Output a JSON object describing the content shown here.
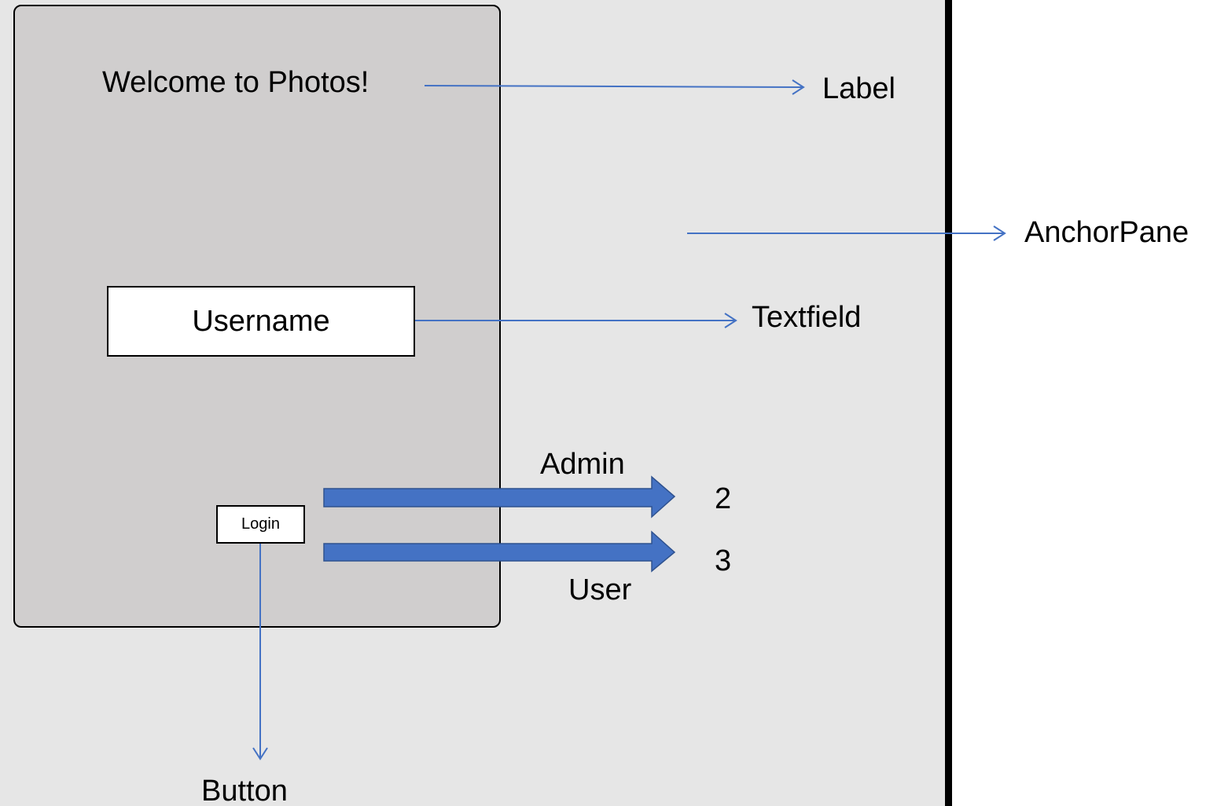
{
  "colors": {
    "anchor_pane_background": "#e6e6e6",
    "login_panel_background": "#d0cece",
    "thin_arrow": "#4472c4",
    "block_arrow_fill": "#4472c4",
    "block_arrow_stroke": "#2f528f",
    "divider": "#000000"
  },
  "ui": {
    "welcome_label": "Welcome to Photos!",
    "username_placeholder": "Username",
    "login_button": "Login"
  },
  "annotations": {
    "label": "Label",
    "anchor_pane": "AnchorPane",
    "textfield": "Textfield",
    "button": "Button",
    "admin": "Admin",
    "admin_target": "2",
    "user": "User",
    "user_target": "3"
  }
}
